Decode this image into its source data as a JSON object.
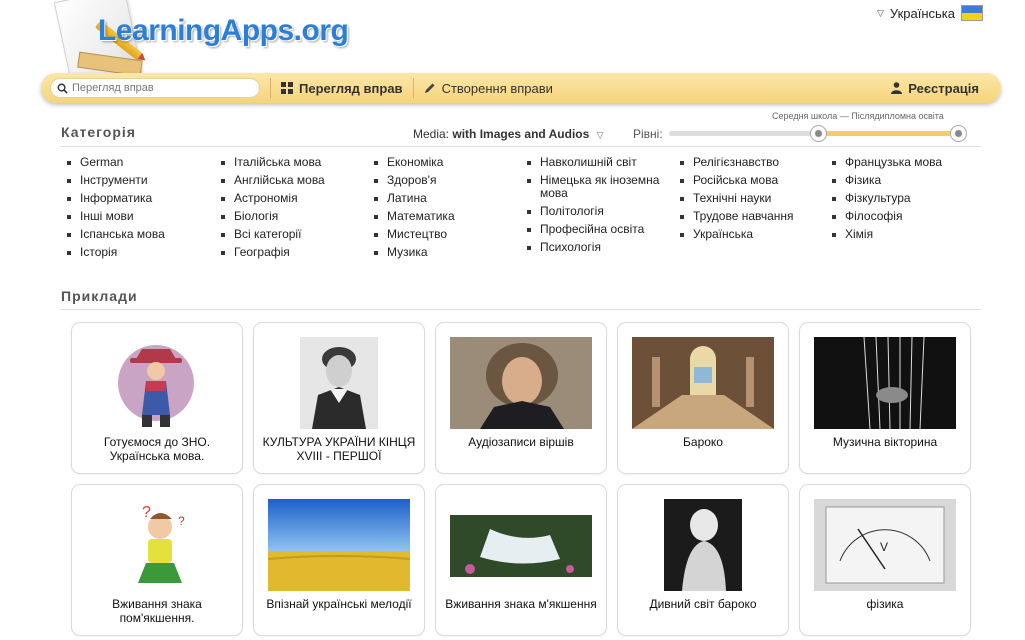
{
  "header": {
    "logo_text": "LearningApps.org",
    "language": "Українська",
    "flag_colors": [
      "#3d7bd9",
      "#f7d20f"
    ]
  },
  "nav": {
    "search_placeholder": "Перегляд вправ",
    "browse_label": "Перегляд вправ",
    "create_label": "Створення вправи",
    "register_label": "Реєстрація"
  },
  "categories": {
    "heading": "Категорія",
    "media_label": "Media:",
    "media_value": "with Images and Audios",
    "levels_label": "Рівні:",
    "levels_range_text": "Середня школа — Післядипломна освіта",
    "levels_fraction_start": 0.5,
    "levels_fraction_end": 1.0,
    "columns": [
      [
        "German",
        "Інструменти",
        "Інформатика",
        "Інші мови",
        "Іспанська мова",
        "Історія"
      ],
      [
        "Італійська мова",
        "Англійська мова",
        "Астрономія",
        "Біологія",
        "Всі категорії",
        "Географія"
      ],
      [
        "Економіка",
        "Здоров'я",
        "Латина",
        "Математика",
        "Мистецтво",
        "Музика"
      ],
      [
        "Навколишній світ",
        "Німецька як іноземна мова",
        "Політологія",
        "Професійна освіта",
        "Психологія"
      ],
      [
        "Релігієзнавство",
        "Російська мова",
        "Технічні науки",
        "Трудове навчання",
        "Українська"
      ],
      [
        "Французька мова",
        "Фізика",
        "Фізкультура",
        "Філософія",
        "Хімія"
      ]
    ]
  },
  "examples": {
    "heading": "Приклади",
    "cards": [
      {
        "title": "Готуємося до ЗНО. Українська мова.",
        "image": "cartoon-girl-image"
      },
      {
        "title": "КУЛЬТУРА УКРАЇНИ КІНЦЯ XVIII - ПЕРШОЇ",
        "image": "portrait-engraving-image"
      },
      {
        "title": "Аудіозаписи віршів",
        "image": "woman-portrait-image"
      },
      {
        "title": "Бароко",
        "image": "baroque-hall-image"
      },
      {
        "title": "Музична вікторина",
        "image": "harp-image"
      },
      {
        "title": "Вживання знака пом'якшення.",
        "image": "thinking-boy-image"
      },
      {
        "title": "Впізнай українські мелодії",
        "image": "wheat-field-image"
      },
      {
        "title": "Вживання знака м'якшення",
        "image": "waterfall-image"
      },
      {
        "title": "Дивний світ бароко",
        "image": "statue-image"
      },
      {
        "title": "фізика",
        "image": "voltmeter-image"
      }
    ]
  }
}
